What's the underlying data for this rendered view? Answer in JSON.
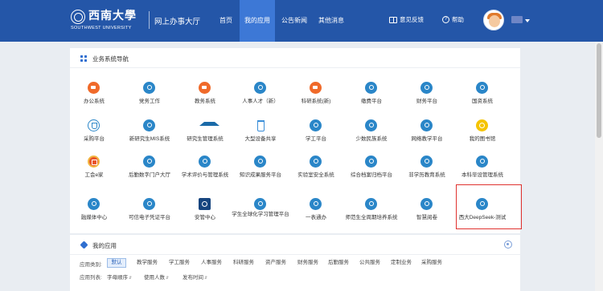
{
  "header": {
    "logo_cn": "西南大學",
    "logo_en": "SOUTHWEST UNIVERSITY",
    "app_title": "网上办事大厅",
    "nav": [
      {
        "label": "首页",
        "active": false
      },
      {
        "label": "我的应用",
        "active": true
      },
      {
        "label": "公告新闻",
        "active": false
      },
      {
        "label": "其他消息",
        "active": false
      }
    ],
    "feedback_label": "意见反馈",
    "help_label": "帮助",
    "help_icon_text": "?"
  },
  "nav_panel": {
    "title": "业务系统导航",
    "apps": [
      {
        "label": "办公系统",
        "icon": "orange"
      },
      {
        "label": "党务工作",
        "icon": "blue"
      },
      {
        "label": "教务系统",
        "icon": "orange"
      },
      {
        "label": "人事人才（新）",
        "icon": "blue"
      },
      {
        "label": "科研系统(新)",
        "icon": "orange"
      },
      {
        "label": "缴费平台",
        "icon": "blue"
      },
      {
        "label": "财务平台",
        "icon": "blue"
      },
      {
        "label": "国资系统",
        "icon": "blue"
      },
      {
        "label": "采购平台",
        "icon": "shield"
      },
      {
        "label": "新研究生MIS系统",
        "icon": "blue"
      },
      {
        "label": "研究生管理系统",
        "icon": "cap"
      },
      {
        "label": "大型设备共享",
        "icon": "flask"
      },
      {
        "label": "学工平台",
        "icon": "blue"
      },
      {
        "label": "少数民族系统",
        "icon": "blue"
      },
      {
        "label": "网络教学平台",
        "icon": "blue"
      },
      {
        "label": "我的图书馆",
        "icon": "yellow"
      },
      {
        "label": "工会e家",
        "icon": "union"
      },
      {
        "label": "后勤数字门户大厅",
        "icon": "blue"
      },
      {
        "label": "学术评价与管理系统",
        "icon": "blue"
      },
      {
        "label": "知识成果服务平台",
        "icon": "blue"
      },
      {
        "label": "实验室安全系统",
        "icon": "blue"
      },
      {
        "label": "综合档案归档平台",
        "icon": "blue"
      },
      {
        "label": "非学历教育系统",
        "icon": "blue"
      },
      {
        "label": "本科毕设管理系统",
        "icon": "blue"
      },
      {
        "label": "融媒体中心",
        "icon": "blue"
      },
      {
        "label": "可信电子凭证平台",
        "icon": "blue"
      },
      {
        "label": "安管中心",
        "icon": "square"
      },
      {
        "label": "学生全球化学习管理平台",
        "icon": "blue"
      },
      {
        "label": "一表通办",
        "icon": "blue"
      },
      {
        "label": "师范生全周期培养系统",
        "icon": "blue"
      },
      {
        "label": "智慧阅卷",
        "icon": "blue"
      },
      {
        "label": "西大DeepSeek-测试",
        "icon": "blue",
        "highlighted": true
      }
    ]
  },
  "my_apps": {
    "title": "我的应用",
    "category_label": "应用类别:",
    "categories": [
      {
        "label": "默认",
        "active": true
      },
      {
        "label": "教学服务",
        "active": false
      },
      {
        "label": "学工服务",
        "active": false
      },
      {
        "label": "人事服务",
        "active": false
      },
      {
        "label": "科研服务",
        "active": false
      },
      {
        "label": "资产服务",
        "active": false
      },
      {
        "label": "财务服务",
        "active": false
      },
      {
        "label": "后勤服务",
        "active": false
      },
      {
        "label": "公共服务",
        "active": false
      },
      {
        "label": "定制业务",
        "active": false
      },
      {
        "label": "采购服务",
        "active": false
      }
    ],
    "list_label": "应用列表:",
    "sort_options": [
      "字母顺序",
      "使用人数",
      "发布时间"
    ],
    "sort_arrow": "⇵"
  }
}
